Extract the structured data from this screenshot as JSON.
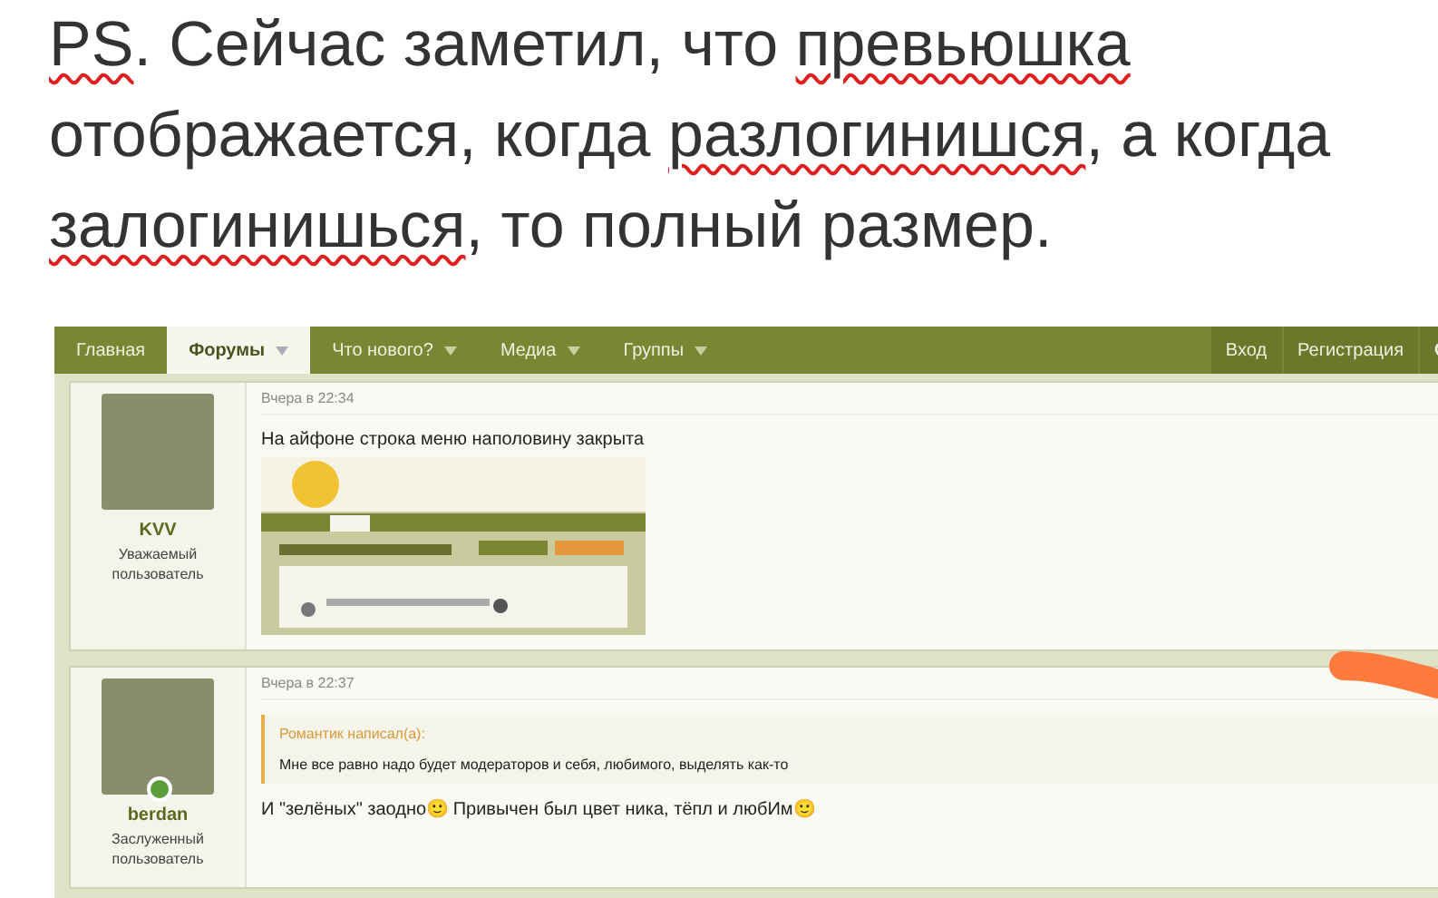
{
  "note": {
    "lines": [
      [
        {
          "text": "PS",
          "misspelled": true
        },
        {
          "text": ". Сейчас заметил, что ",
          "misspelled": false
        },
        {
          "text": "превьюшка",
          "misspelled": true
        }
      ],
      [
        {
          "text": "отображается, когда ",
          "misspelled": false
        },
        {
          "text": "разлогинишся",
          "misspelled": true
        },
        {
          "text": ", а когда",
          "misspelled": false
        }
      ],
      [
        {
          "text": "залогинишься",
          "misspelled": true
        },
        {
          "text": ", то полный размер.",
          "misspelled": false
        }
      ]
    ]
  },
  "forum": {
    "nav": [
      {
        "label": "Главная",
        "selected": false,
        "dropdown": false
      },
      {
        "label": "Форумы",
        "selected": true,
        "dropdown": true
      },
      {
        "label": "Что нового?",
        "selected": false,
        "dropdown": true
      },
      {
        "label": "Медиа",
        "selected": false,
        "dropdown": true
      },
      {
        "label": "Группы",
        "selected": false,
        "dropdown": true
      }
    ],
    "account": [
      "Вход",
      "Регистрация"
    ],
    "posts": [
      {
        "user": "KVV",
        "role": "Уважаемый пользователь",
        "online": false,
        "time": "Вчера в 22:34",
        "text": "На айфоне строка меню наполовину закрыта",
        "attachment": true
      },
      {
        "user": "berdan",
        "role": "Заслуженный пользователь",
        "online": true,
        "time": "Вчера в 22:37",
        "quote": {
          "author": "Романтик написал(а):",
          "text": "Мне все равно надо будет модераторов и себя, любимого, выделять как-то"
        },
        "text": "И \"зелёных\" заодно🙂 Привычен был цвет ника, тёпл и любИм🙂",
        "attachment": false
      }
    ]
  }
}
